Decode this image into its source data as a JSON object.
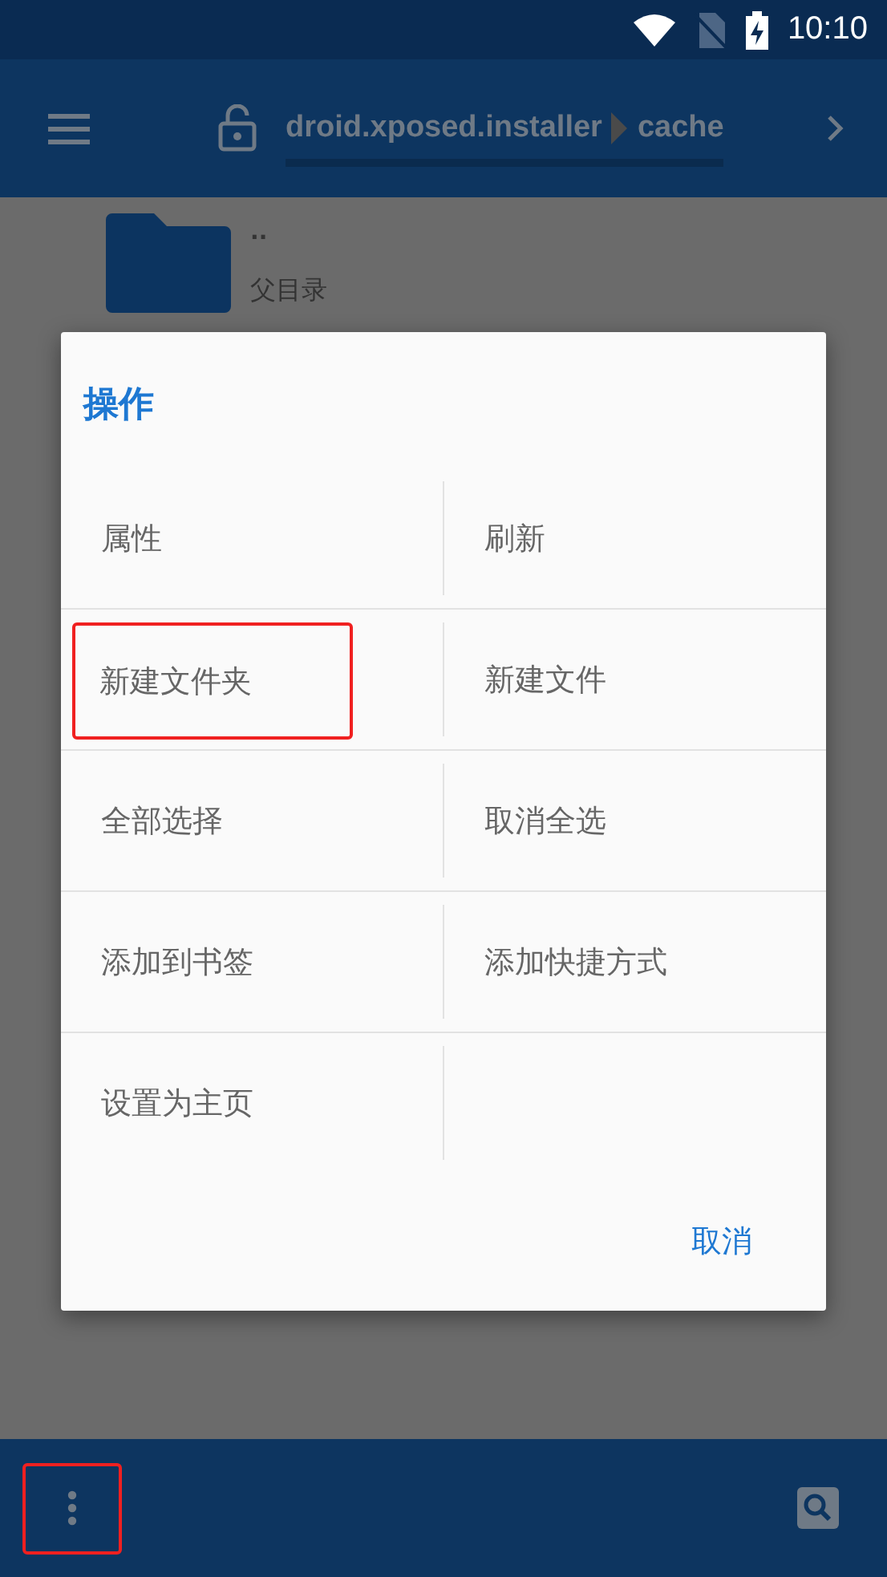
{
  "status_bar": {
    "time": "10:10"
  },
  "toolbar": {
    "breadcrumb": [
      "droid.xposed.installer",
      "cache"
    ]
  },
  "file_list": [
    {
      "name": "..",
      "description": "父目录"
    }
  ],
  "dialog": {
    "title": "操作",
    "items": [
      {
        "label": "属性",
        "highlighted": false
      },
      {
        "label": "刷新",
        "highlighted": false
      },
      {
        "label": "新建文件夹",
        "highlighted": true
      },
      {
        "label": "新建文件",
        "highlighted": false
      },
      {
        "label": "全部选择",
        "highlighted": false
      },
      {
        "label": "取消全选",
        "highlighted": false
      },
      {
        "label": "添加到书签",
        "highlighted": false
      },
      {
        "label": "添加快捷方式",
        "highlighted": false
      },
      {
        "label": "设置为主页",
        "highlighted": false
      }
    ],
    "buttons": [
      "取消"
    ]
  },
  "bottom_bar": {
    "menu_highlighted": true
  }
}
